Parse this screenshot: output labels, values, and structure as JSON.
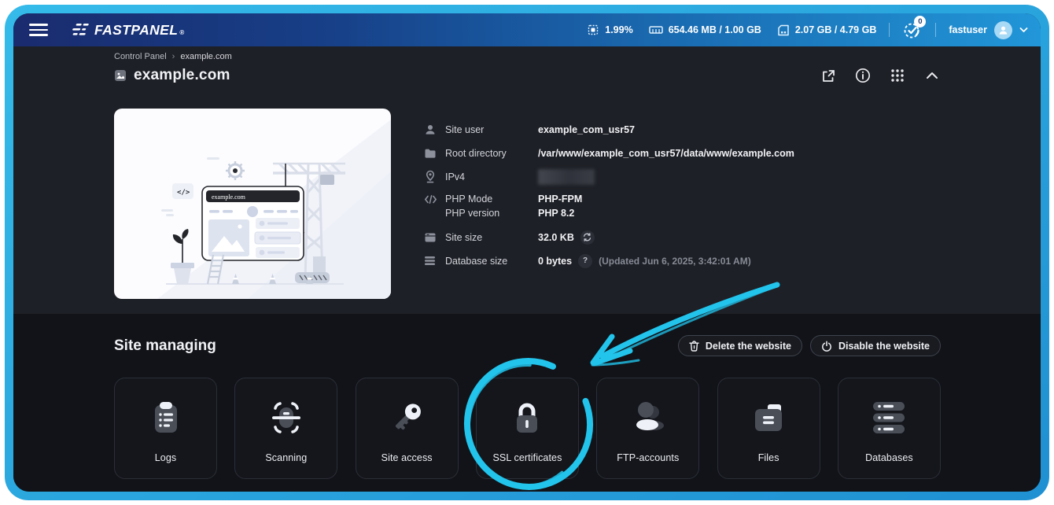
{
  "topbar": {
    "brand": "FASTPANEL",
    "brand_mark": "®",
    "cpu_percent": "1.99%",
    "ram_usage": "654.46 MB / 1.00 GB",
    "disk_usage": "2.07 GB / 4.79 GB",
    "notifications_count": "0",
    "username": "fastuser"
  },
  "breadcrumb": {
    "root": "Control Panel",
    "separator": "›",
    "current": "example.com"
  },
  "page": {
    "title": "example.com"
  },
  "site_info": {
    "illustration_site_label": "example.com",
    "site_user_label": "Site user",
    "site_user_value": "example_com_usr57",
    "root_directory_label": "Root directory",
    "root_directory_value": "/var/www/example_com_usr57/data/www/example.com",
    "ipv4_label": "IPv4",
    "php_mode_label": "PHP Mode",
    "php_mode_value": "PHP-FPM",
    "php_version_label": "PHP version",
    "php_version_value": "PHP 8.2",
    "site_size_label": "Site size",
    "site_size_value": "32.0 KB",
    "database_size_label": "Database size",
    "database_size_value": "0 bytes",
    "database_size_hint": "?",
    "database_size_updated": "(Updated Jun 6, 2025, 3:42:01 AM)"
  },
  "managing": {
    "title": "Site managing",
    "delete_button": "Delete the website",
    "disable_button": "Disable the website",
    "cards": [
      {
        "label": "Logs"
      },
      {
        "label": "Scanning"
      },
      {
        "label": "Site access"
      },
      {
        "label": "SSL certificates"
      },
      {
        "label": "FTP-accounts"
      },
      {
        "label": "Files"
      },
      {
        "label": "Databases"
      }
    ]
  },
  "colors": {
    "frame_cyan": "#29b3e4",
    "annotation_cyan": "#22c4ec",
    "header_gradient_start": "#1a2b6e",
    "header_gradient_end": "#2196d8",
    "section_top_bg": "#1e2027",
    "section_bottom_bg": "#111318",
    "card_bg": "#14161c"
  }
}
